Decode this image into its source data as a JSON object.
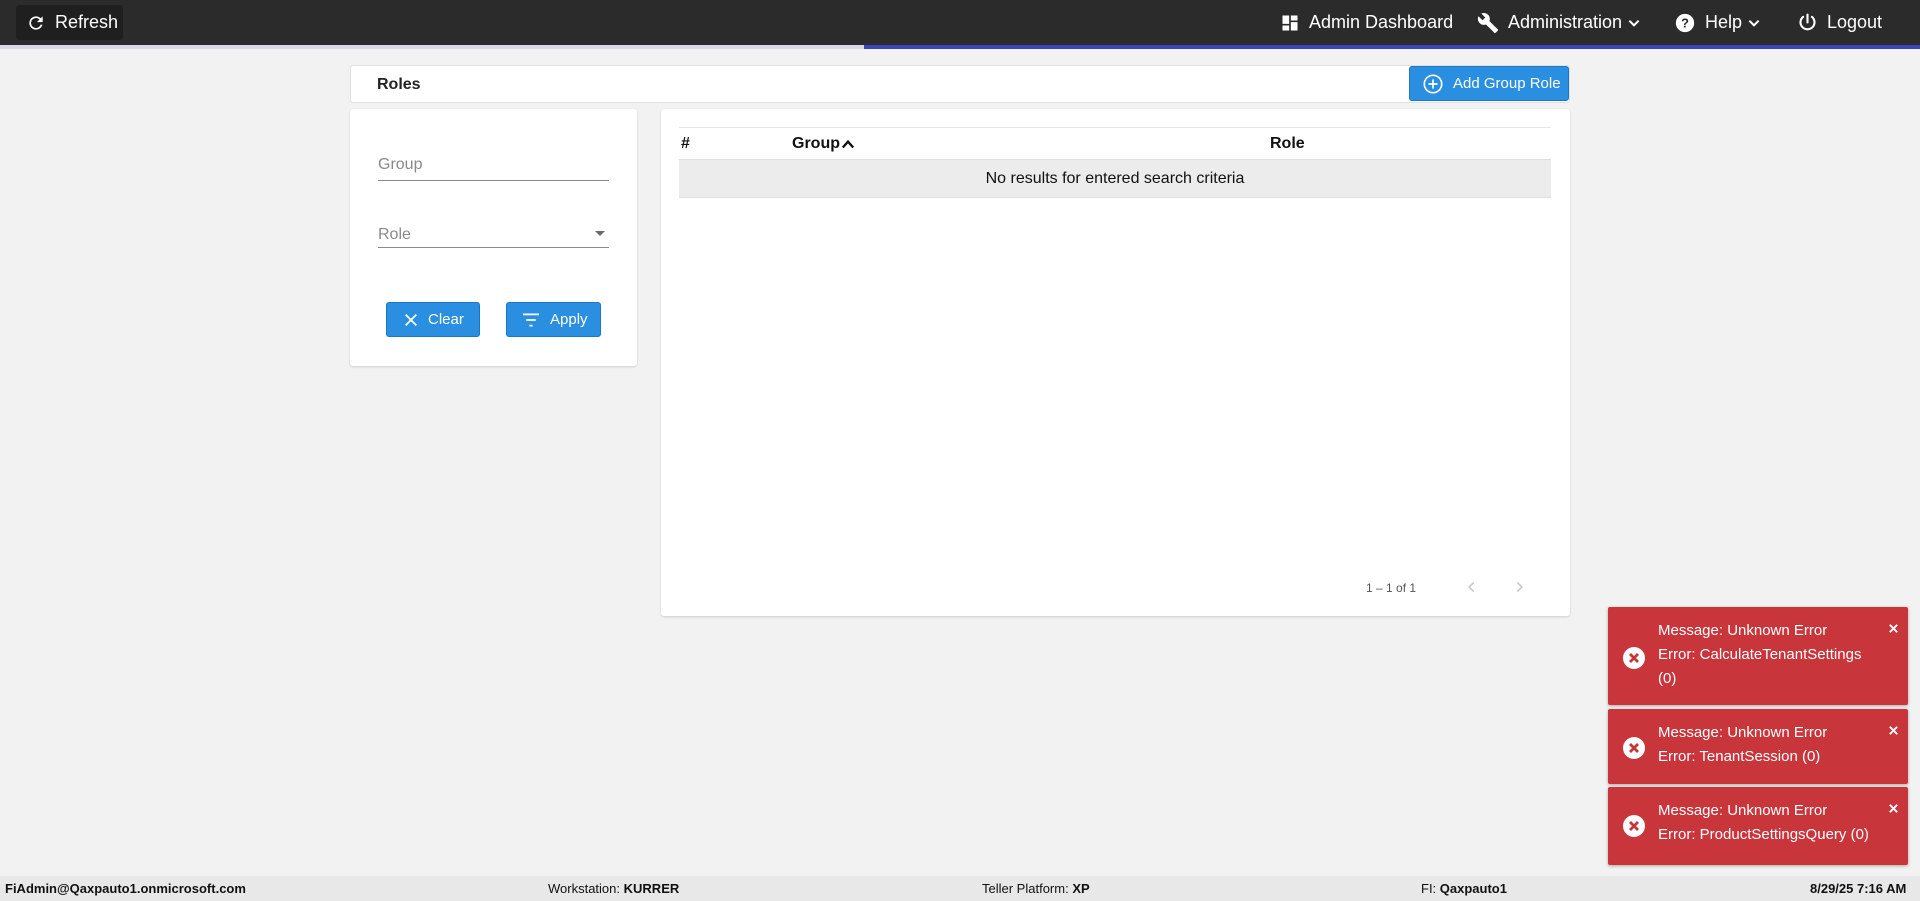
{
  "topbar": {
    "refresh_label": "Refresh",
    "admin_dashboard_label": "Admin Dashboard",
    "administration_label": "Administration",
    "help_label": "Help",
    "logout_label": "Logout",
    "progress_fraction": 0.55
  },
  "page": {
    "title": "Roles",
    "add_button_label": "Add Group Role"
  },
  "filters": {
    "group_placeholder": "Group",
    "group_value": "",
    "role_placeholder": "Role",
    "clear_label": "Clear",
    "apply_label": "Apply"
  },
  "table": {
    "columns": [
      "#",
      "Group",
      "Role"
    ],
    "sorted_column": "Group",
    "sort_direction": "ascending",
    "empty_message": "No results for entered search criteria",
    "pagination": "1 – 1 of 1"
  },
  "toasts": [
    {
      "line1": "Message: Unknown Error",
      "line2": "Error: CalculateTenantSettings (0)"
    },
    {
      "line1": "Message: Unknown Error",
      "line2": "Error: TenantSession (0)"
    },
    {
      "line1": "Message: Unknown Error",
      "line2": "Error: ProductSettingsQuery (0)"
    }
  ],
  "statusbar": {
    "user": "FiAdmin@Qaxpauto1.onmicrosoft.com",
    "workstation_label": "Workstation:",
    "workstation_value": "KURRER",
    "platform_label": "Teller Platform:",
    "platform_value": "XP",
    "fi_label": "FI:",
    "fi_value": "Qaxpauto1",
    "datetime": "8/29/25 7:16 AM"
  },
  "colors": {
    "accent_blue": "#2a8fe0",
    "topbar_bg": "#2b2b2b",
    "progress_blue": "#3a46b9",
    "error_red": "#c8353a"
  },
  "icons": {
    "refresh": "refresh-icon",
    "dashboard": "dashboard-icon",
    "administration": "wrench-icon",
    "help": "help-circle-icon",
    "logout": "power-icon",
    "add": "plus-circle-icon",
    "clear": "close-icon",
    "apply": "filter-icon",
    "toast_error": "error-circle-icon",
    "toast_close": "close-icon"
  }
}
